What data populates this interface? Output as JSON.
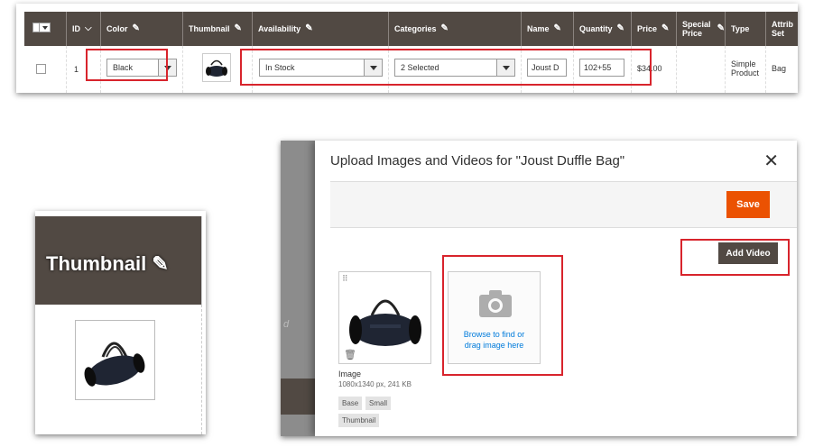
{
  "grid": {
    "columns": [
      {
        "label": ""
      },
      {
        "label": "ID",
        "sort": "⌵"
      },
      {
        "label": "Color",
        "pen": "✎"
      },
      {
        "label": "Thumbnail",
        "pen": "✎"
      },
      {
        "label": "Availability",
        "pen": "✎"
      },
      {
        "label": "Categories",
        "pen": "✎"
      },
      {
        "label": "Name",
        "pen": "✎"
      },
      {
        "label": "Quantity",
        "pen": "✎"
      },
      {
        "label": "Price",
        "pen": "✎"
      },
      {
        "label": "Special Price",
        "pen": "✎"
      },
      {
        "label": "Type"
      },
      {
        "label": "Attrib Set"
      }
    ],
    "row": {
      "id": "1",
      "color": "Black",
      "availability": "In Stock",
      "categories": "2 Selected",
      "name": "Joust D",
      "quantity": "102+55",
      "price": "$34.00",
      "type": "Simple Product",
      "attribute_set": "Bag"
    }
  },
  "zoom": {
    "title": "Thumbnail",
    "pen": "✎"
  },
  "modal": {
    "title": "Upload Images and Videos for \"Joust Duffle Bag\"",
    "close": "✕",
    "save": "Save",
    "add_video": "Add Video",
    "upload_text_1": "Browse to find or",
    "upload_text_2": "drag image here",
    "image_label": "Image",
    "image_meta": "1080x1340 px, 241 KB",
    "roles": [
      "Base",
      "Small",
      "Thumbnail"
    ],
    "bg_hint": "d"
  },
  "colors": {
    "header": "#514943",
    "accent": "#eb5202",
    "highlight": "#d8242c",
    "link": "#007bdb"
  }
}
